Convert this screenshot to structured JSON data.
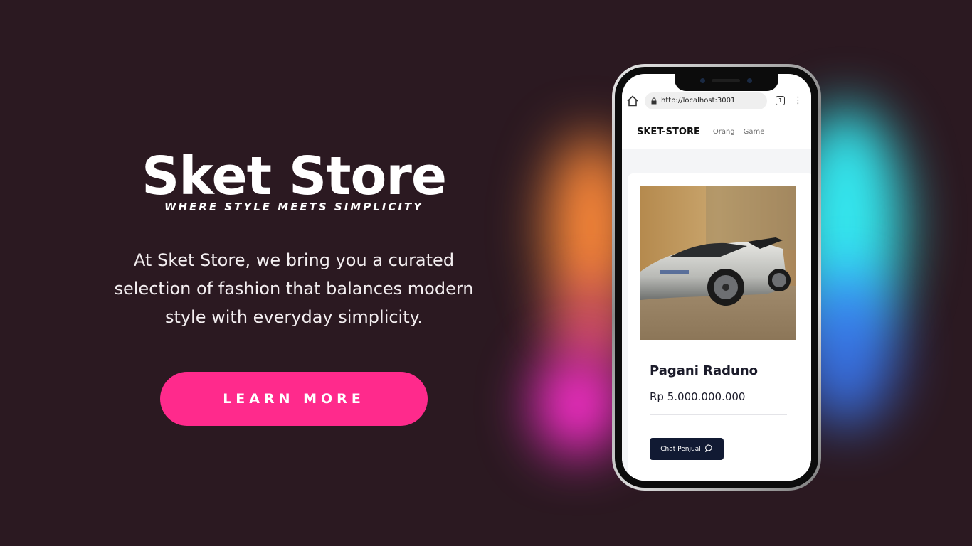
{
  "hero": {
    "title": "Sket Store",
    "tagline": "WHERE STYLE MEETS SIMPLICITY",
    "description": "At Sket Store, we bring you a curated selection of fashion that balances modern style with everyday simplicity.",
    "cta_label": "LEARN MORE"
  },
  "colors": {
    "background": "#2b1921",
    "cta": "#ff2a8c",
    "button_dark": "#111a33"
  },
  "phone": {
    "browser": {
      "url": "http://localhost:3001",
      "tab_count": "1",
      "icons": [
        "home-icon",
        "lock-icon",
        "tabs-icon",
        "more-vert-icon"
      ]
    },
    "site": {
      "logo": "SKET-STORE",
      "nav": [
        {
          "label": "Orang"
        },
        {
          "label": "Game"
        }
      ]
    },
    "product": {
      "name": "Pagani Raduno",
      "price": "Rp 5.000.000.000",
      "chat_label": "Chat Penjual",
      "chat_icon": "chat-bubble-icon"
    }
  }
}
